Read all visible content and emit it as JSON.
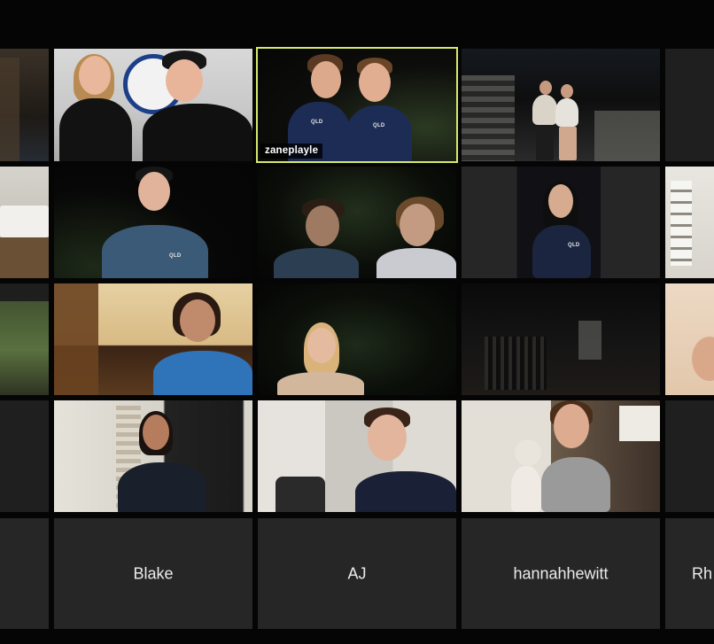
{
  "participants": {
    "active_speaker": "zaneplayle",
    "named_tiles": [
      "Blake",
      "AJ",
      "hannahhewitt",
      "Rh"
    ]
  },
  "colors": {
    "background": "#050505",
    "tile_background": "#1f1f1f",
    "active_speaker_border": "#d7e86a",
    "name_text": "#ececec"
  }
}
